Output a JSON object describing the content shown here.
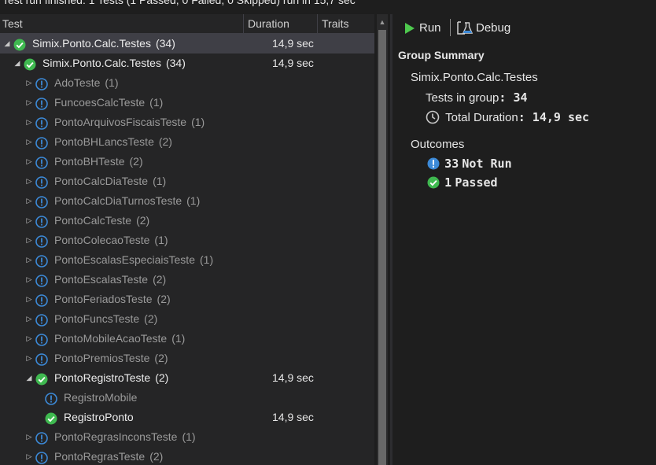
{
  "status_text": "Test run finished: 1 Tests (1 Passed, 0 Failed, 0 Skipped) run in 15,7 sec",
  "columns": {
    "test": "Test",
    "duration": "Duration",
    "traits": "Traits"
  },
  "tree": [
    {
      "name": "Simix.Ponto.Calc.Testes",
      "count": "(34)",
      "duration": "14,9 sec",
      "status": "passed",
      "expander": "expanded",
      "bright": true,
      "selected": true
    },
    {
      "name": "Simix.Ponto.Calc.Testes",
      "count": "(34)",
      "duration": "14,9 sec",
      "status": "passed",
      "expander": "expanded",
      "bright": true
    },
    {
      "name": "AdoTeste",
      "count": "(1)",
      "duration": "",
      "status": "notrun",
      "expander": "collapsed"
    },
    {
      "name": "FuncoesCalcTeste",
      "count": "(1)",
      "duration": "",
      "status": "notrun",
      "expander": "collapsed"
    },
    {
      "name": "PontoArquivosFiscaisTeste",
      "count": "(1)",
      "duration": "",
      "status": "notrun",
      "expander": "collapsed"
    },
    {
      "name": "PontoBHLancsTeste",
      "count": "(2)",
      "duration": "",
      "status": "notrun",
      "expander": "collapsed"
    },
    {
      "name": "PontoBHTeste",
      "count": "(2)",
      "duration": "",
      "status": "notrun",
      "expander": "collapsed"
    },
    {
      "name": "PontoCalcDiaTeste",
      "count": "(1)",
      "duration": "",
      "status": "notrun",
      "expander": "collapsed"
    },
    {
      "name": "PontoCalcDiaTurnosTeste",
      "count": "(1)",
      "duration": "",
      "status": "notrun",
      "expander": "collapsed"
    },
    {
      "name": "PontoCalcTeste",
      "count": "(2)",
      "duration": "",
      "status": "notrun",
      "expander": "collapsed"
    },
    {
      "name": "PontoColecaoTeste",
      "count": "(1)",
      "duration": "",
      "status": "notrun",
      "expander": "collapsed"
    },
    {
      "name": "PontoEscalasEspeciaisTeste",
      "count": "(1)",
      "duration": "",
      "status": "notrun",
      "expander": "collapsed"
    },
    {
      "name": "PontoEscalasTeste",
      "count": "(2)",
      "duration": "",
      "status": "notrun",
      "expander": "collapsed"
    },
    {
      "name": "PontoFeriadosTeste",
      "count": "(2)",
      "duration": "",
      "status": "notrun",
      "expander": "collapsed"
    },
    {
      "name": "PontoFuncsTeste",
      "count": "(2)",
      "duration": "",
      "status": "notrun",
      "expander": "collapsed"
    },
    {
      "name": "PontoMobileAcaoTeste",
      "count": "(1)",
      "duration": "",
      "status": "notrun",
      "expander": "collapsed"
    },
    {
      "name": "PontoPremiosTeste",
      "count": "(2)",
      "duration": "",
      "status": "notrun",
      "expander": "collapsed"
    },
    {
      "name": "PontoRegistroTeste",
      "count": "(2)",
      "duration": "14,9 sec",
      "status": "passed",
      "expander": "expanded",
      "bright": true
    },
    {
      "name": "RegistroMobile",
      "count": "",
      "duration": "",
      "status": "notrun",
      "expander": "none"
    },
    {
      "name": "RegistroPonto",
      "count": "",
      "duration": "14,9 sec",
      "status": "passed",
      "expander": "none",
      "bright": true
    },
    {
      "name": "PontoRegrasInconsTeste",
      "count": "(1)",
      "duration": "",
      "status": "notrun",
      "expander": "collapsed"
    },
    {
      "name": "PontoRegrasTeste",
      "count": "(2)",
      "duration": "",
      "status": "notrun",
      "expander": "collapsed"
    }
  ],
  "toolbar": {
    "run": "Run",
    "debug": "Debug"
  },
  "summary": {
    "heading": "Group Summary",
    "group_name": "Simix.Ponto.Calc.Testes",
    "tests_label": "Tests in group",
    "tests_value": "34",
    "duration_label": "Total Duration",
    "duration_value": "14,9 sec",
    "outcomes_heading": "Outcomes",
    "not_run_count": "33",
    "not_run_label": "Not Run",
    "passed_count": "1",
    "passed_label": "Passed"
  },
  "colors": {
    "passed": "#3fb950",
    "notrun": "#3c8ad8",
    "selection": "#3f3f46",
    "accent_run": "#4ec94e"
  }
}
